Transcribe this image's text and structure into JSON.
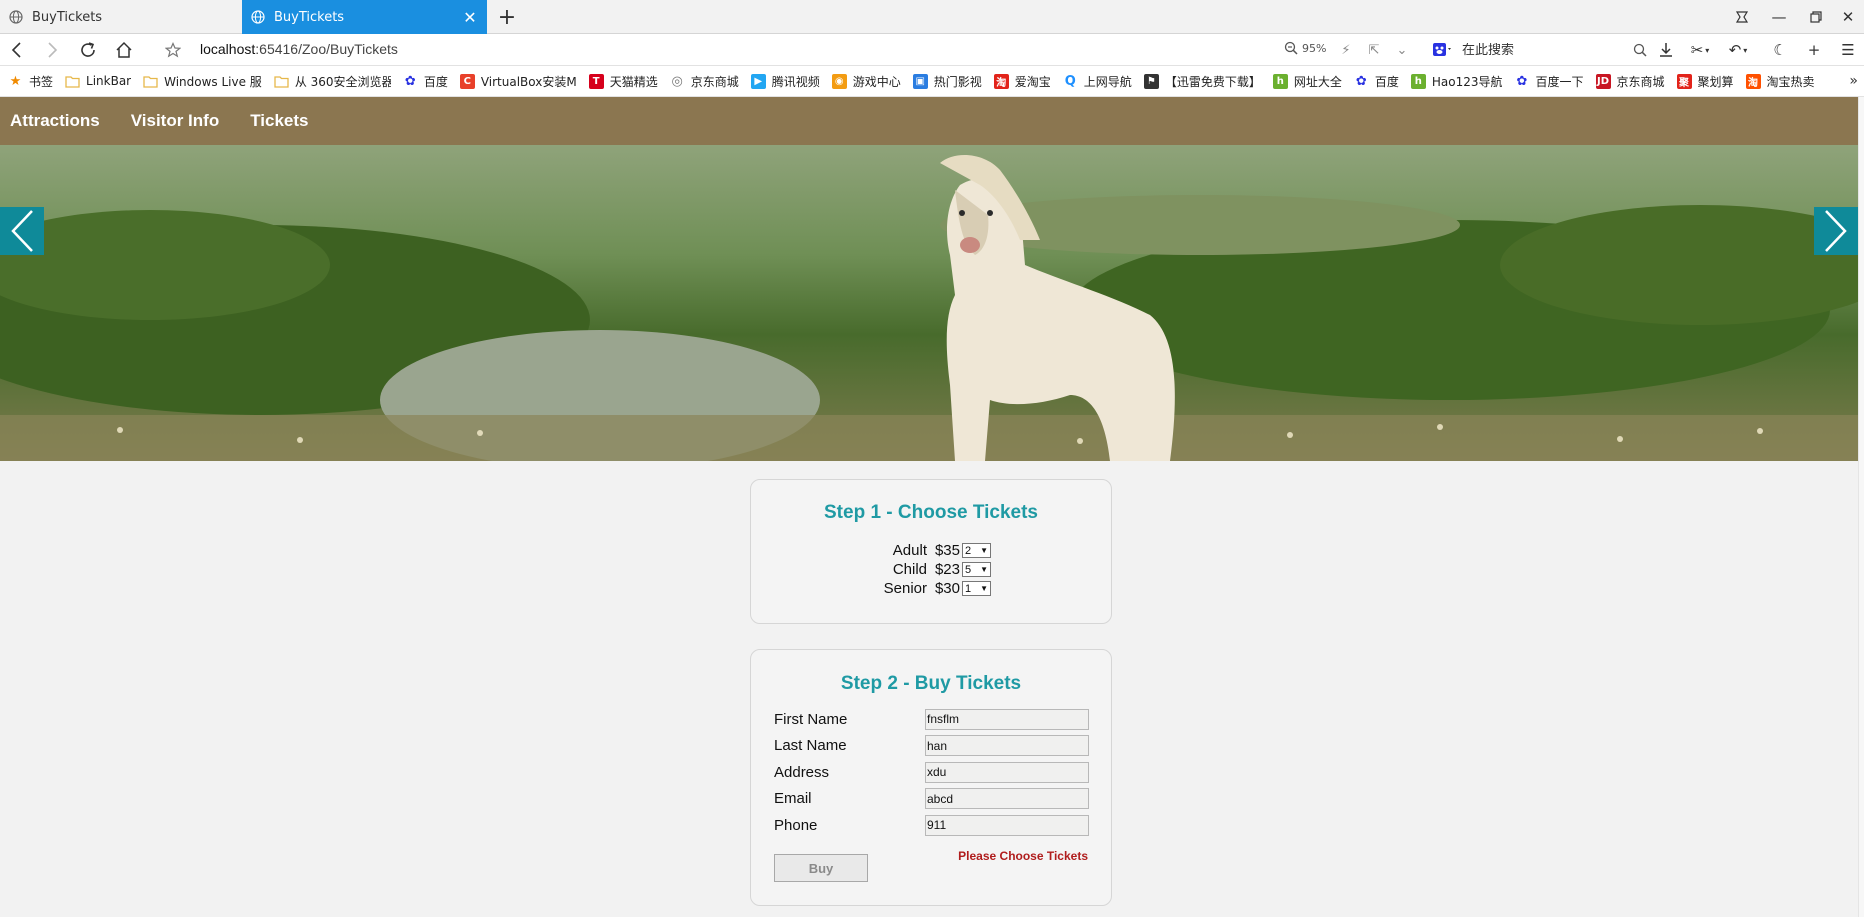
{
  "browser": {
    "tabs": [
      {
        "title": "BuyTickets",
        "active": false
      },
      {
        "title": "BuyTickets",
        "active": true
      }
    ],
    "url_host": "localhost",
    "url_path": ":65416/Zoo/BuyTickets",
    "zoom": "95%",
    "search_placeholder": "在此搜索"
  },
  "bookmarks": [
    {
      "label": "书签",
      "icon": "star-icon",
      "color": "#f08a00"
    },
    {
      "label": "LinkBar",
      "icon": "folder-icon",
      "color": "#e6b84a"
    },
    {
      "label": "Windows Live 服",
      "icon": "folder-icon",
      "color": "#e6b84a"
    },
    {
      "label": "从 360安全浏览器",
      "icon": "folder-icon",
      "color": "#e6b84a"
    },
    {
      "label": "百度",
      "icon": "baidu-paw-icon",
      "color": "#2932e1"
    },
    {
      "label": "VirtualBox安装M",
      "icon": "c-icon",
      "color": "#e8402a"
    },
    {
      "label": "天猫精选",
      "icon": "tmall-icon",
      "color": "#d6001c"
    },
    {
      "label": "京东商城",
      "icon": "globe-icon",
      "color": "#777777"
    },
    {
      "label": "腾讯视频",
      "icon": "play-icon",
      "color": "#22a6f2"
    },
    {
      "label": "游戏中心",
      "icon": "gamepad-icon",
      "color": "#f39c12"
    },
    {
      "label": "热门影视",
      "icon": "video-icon",
      "color": "#2a7de1"
    },
    {
      "label": "爱淘宝",
      "icon": "ai-taobao-icon",
      "color": "#e2231a"
    },
    {
      "label": "上网导航",
      "icon": "nav-q-icon",
      "color": "#1e90ff"
    },
    {
      "label": "【迅雷免费下载】",
      "icon": "xunlei-icon",
      "color": "#333333"
    },
    {
      "label": "网址大全",
      "icon": "hao-icon",
      "color": "#6bb02f"
    },
    {
      "label": "百度",
      "icon": "baidu-paw-icon",
      "color": "#2932e1"
    },
    {
      "label": "Hao123导航",
      "icon": "hao-icon",
      "color": "#6bb02f"
    },
    {
      "label": "百度一下",
      "icon": "baidu-paw-icon",
      "color": "#2932e1"
    },
    {
      "label": "京东商城",
      "icon": "jd-icon",
      "color": "#c81623"
    },
    {
      "label": "聚划算",
      "icon": "juhuasuan-icon",
      "color": "#e2231a"
    },
    {
      "label": "淘宝热卖",
      "icon": "taobao-icon",
      "color": "#ff5000"
    }
  ],
  "site": {
    "nav": [
      "Attractions",
      "Visitor Info",
      "Tickets"
    ],
    "nav_color": "#8b7650",
    "accent": "#1f9aa4"
  },
  "step1": {
    "title": "Step 1 - Choose Tickets",
    "tickets": [
      {
        "label": "Adult",
        "price": "$35",
        "qty": "2"
      },
      {
        "label": "Child",
        "price": "$23",
        "qty": "5"
      },
      {
        "label": "Senior",
        "price": "$30",
        "qty": "1"
      }
    ]
  },
  "step2": {
    "title": "Step 2 - Buy Tickets",
    "fields": [
      {
        "label": "First Name",
        "value": "fnsflm"
      },
      {
        "label": "Last Name",
        "value": "han"
      },
      {
        "label": "Address",
        "value": "xdu"
      },
      {
        "label": "Email",
        "value": "abcd"
      },
      {
        "label": "Phone",
        "value": "911"
      }
    ],
    "buy_label": "Buy",
    "error": "Please Choose Tickets"
  }
}
